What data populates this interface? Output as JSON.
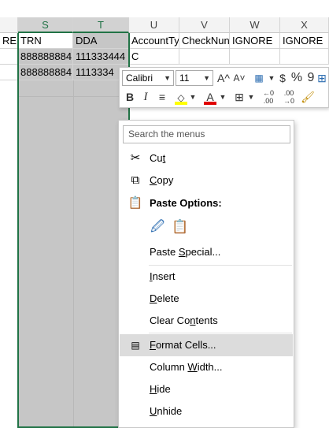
{
  "columns": {
    "left_partial": "",
    "s": "S",
    "t": "T",
    "u": "U",
    "v": "V",
    "w": "W",
    "x": "X"
  },
  "header_row": {
    "left_partial": "RE",
    "trn": "TRN",
    "dda": "DDA",
    "account_type": "AccountTy",
    "check_number": "CheckNun",
    "ignore_1": "IGNORE",
    "ignore_2": "IGNORE"
  },
  "data_rows": [
    {
      "trn": "888888884",
      "dda": "111333444",
      "account_type": "C"
    },
    {
      "trn": "888888884",
      "dda": "1113334",
      "account_type": ""
    }
  ],
  "mini_toolbar": {
    "font_name": "Calibri",
    "font_size": "11",
    "grow_font": "A^",
    "shrink_font": "A˅",
    "accounting_format": "$",
    "percent": "%",
    "comma": "9",
    "bold": "B",
    "italic": "I",
    "font_color_letter": "A",
    "highlight_color": "#ffff00",
    "font_color": "#e00000"
  },
  "context_menu": {
    "search_placeholder": "Search the menus",
    "cut": {
      "pre": "Cu",
      "key": "t",
      "post": ""
    },
    "copy": {
      "pre": "",
      "key": "C",
      "post": "opy"
    },
    "paste_options": "Paste Options:",
    "paste_special": {
      "pre": "Paste ",
      "key": "S",
      "post": "pecial..."
    },
    "insert": {
      "pre": "",
      "key": "I",
      "post": "nsert"
    },
    "delete": {
      "pre": "",
      "key": "D",
      "post": "elete"
    },
    "clear_contents": {
      "pre": "Clear Co",
      "key": "n",
      "post": "tents"
    },
    "format_cells": {
      "pre": "",
      "key": "F",
      "post": "ormat Cells..."
    },
    "column_width": {
      "pre": "Column ",
      "key": "W",
      "post": "idth..."
    },
    "hide": {
      "pre": "",
      "key": "H",
      "post": "ide"
    },
    "unhide": {
      "pre": "",
      "key": "U",
      "post": "nhide"
    }
  },
  "colors": {
    "excel_green": "#217346",
    "selection_gray": "#c6c6c6",
    "menu_highlight": "#dcdcdc"
  }
}
